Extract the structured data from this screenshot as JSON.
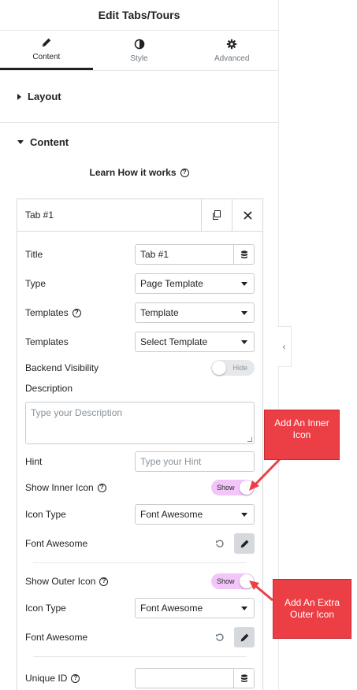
{
  "header": {
    "title": "Edit Tabs/Tours"
  },
  "tabs": [
    {
      "label": "Content",
      "icon": "pencil-icon",
      "active": true
    },
    {
      "label": "Style",
      "icon": "contrast-icon",
      "active": false
    },
    {
      "label": "Advanced",
      "icon": "gear-icon",
      "active": false
    }
  ],
  "sections": {
    "layout": "Layout",
    "content": "Content"
  },
  "learn": {
    "label": "Learn How it works",
    "icon": "question-icon"
  },
  "repeater": {
    "item_title": "Tab #1",
    "duplicate_icon": "copy-icon",
    "remove_icon": "close-icon"
  },
  "fields": {
    "title": {
      "label": "Title",
      "value": "Tab #1",
      "icon": "database-icon"
    },
    "type": {
      "label": "Type",
      "value": "Page Template"
    },
    "templates1": {
      "label": "Templates",
      "value": "Template"
    },
    "templates2": {
      "label": "Templates",
      "value": "Select Template"
    },
    "backend_visibility": {
      "label": "Backend Visibility",
      "toggle": "Hide",
      "on": false
    },
    "description": {
      "label": "Description",
      "placeholder": "Type your Description"
    },
    "hint": {
      "label": "Hint",
      "placeholder": "Type your Hint"
    },
    "show_inner_icon": {
      "label": "Show Inner Icon",
      "toggle": "Show",
      "on": true
    },
    "icon_type1": {
      "label": "Icon Type",
      "value": "Font Awesome"
    },
    "font_awesome1": {
      "label": "Font Awesome"
    },
    "show_outer_icon": {
      "label": "Show Outer Icon",
      "toggle": "Show",
      "on": true
    },
    "icon_type2": {
      "label": "Icon Type",
      "value": "Font Awesome"
    },
    "font_awesome2": {
      "label": "Font Awesome"
    },
    "unique_id": {
      "label": "Unique ID",
      "value": ""
    }
  },
  "collapse": {
    "glyph": "‹"
  },
  "callouts": {
    "inner": "Add An Inner Icon",
    "outer": "Add An Extra Outer Icon"
  },
  "colors": {
    "toggle_on": "#f3c6f9",
    "callout": "#ec3e45",
    "text": "#1f2124"
  }
}
